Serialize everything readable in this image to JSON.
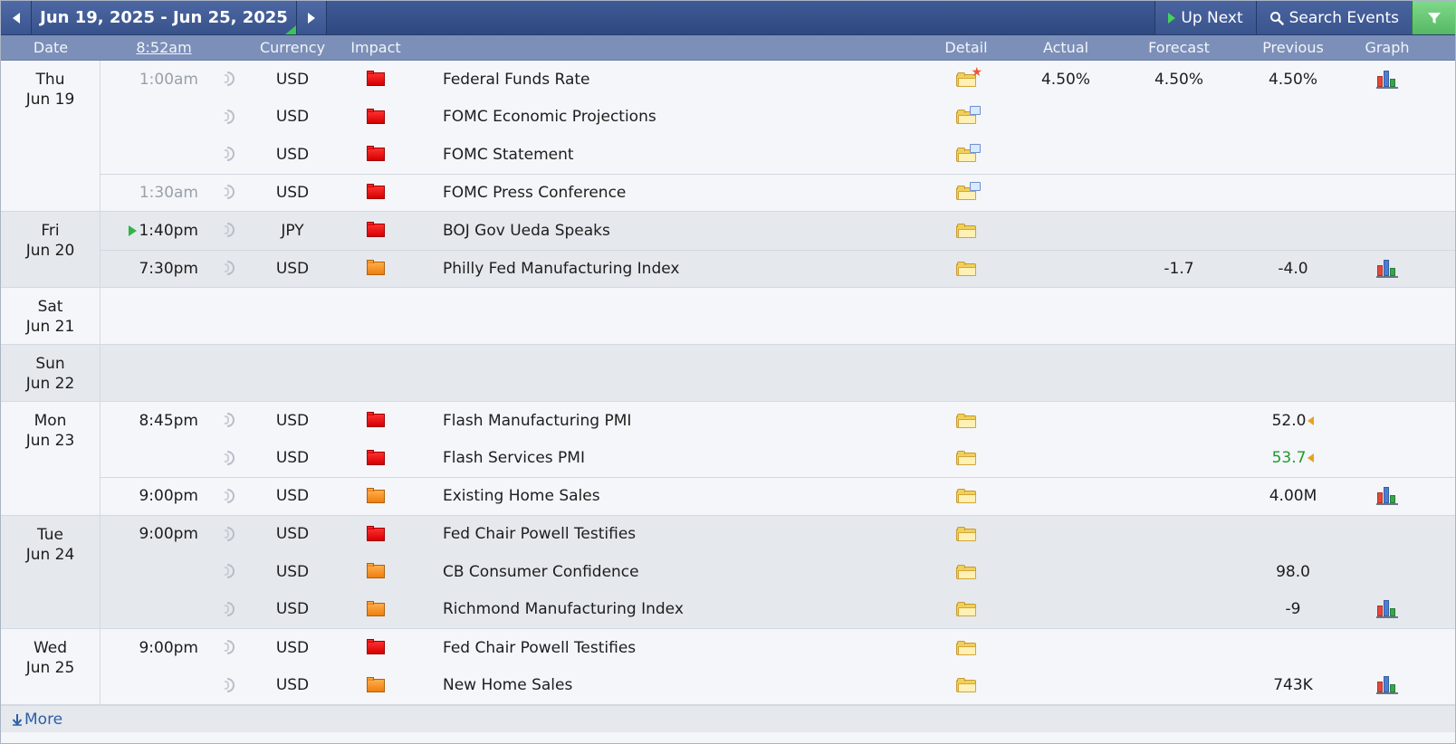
{
  "toolbar": {
    "date_range": "Jun 19, 2025 - Jun 25, 2025",
    "up_next": "Up Next",
    "search_events": "Search Events"
  },
  "headers": {
    "date": "Date",
    "time": "8:52am",
    "currency": "Currency",
    "impact": "Impact",
    "detail": "Detail",
    "actual": "Actual",
    "forecast": "Forecast",
    "previous": "Previous",
    "graph": "Graph"
  },
  "days": [
    {
      "day": "Thu",
      "date": "Jun 19",
      "events": [
        {
          "time": "1:00am",
          "currency": "USD",
          "impact": "high",
          "event": "Federal Funds Rate",
          "actual": "4.50%",
          "forecast": "4.50%",
          "previous": "4.50%"
        },
        {
          "time": "",
          "currency": "USD",
          "impact": "high",
          "event": "FOMC Economic Projections",
          "actual": "",
          "forecast": "",
          "previous": ""
        },
        {
          "time": "",
          "currency": "USD",
          "impact": "high",
          "event": "FOMC Statement",
          "actual": "",
          "forecast": "",
          "previous": ""
        },
        {
          "time": "1:30am",
          "currency": "USD",
          "impact": "high",
          "event": "FOMC Press Conference",
          "actual": "",
          "forecast": "",
          "previous": ""
        }
      ]
    },
    {
      "day": "Fri",
      "date": "Jun 20",
      "events": [
        {
          "time": "1:40pm",
          "currency": "JPY",
          "impact": "high",
          "event": "BOJ Gov Ueda Speaks",
          "actual": "",
          "forecast": "",
          "previous": ""
        },
        {
          "time": "7:30pm",
          "currency": "USD",
          "impact": "medium",
          "event": "Philly Fed Manufacturing Index",
          "actual": "",
          "forecast": "-1.7",
          "previous": "-4.0"
        }
      ]
    },
    {
      "day": "Sat",
      "date": "Jun 21",
      "events": []
    },
    {
      "day": "Sun",
      "date": "Jun 22",
      "events": []
    },
    {
      "day": "Mon",
      "date": "Jun 23",
      "events": [
        {
          "time": "8:45pm",
          "currency": "USD",
          "impact": "high",
          "event": "Flash Manufacturing PMI",
          "actual": "",
          "forecast": "",
          "previous": "52.0"
        },
        {
          "time": "",
          "currency": "USD",
          "impact": "high",
          "event": "Flash Services PMI",
          "actual": "",
          "forecast": "",
          "previous": "53.7"
        },
        {
          "time": "9:00pm",
          "currency": "USD",
          "impact": "medium",
          "event": "Existing Home Sales",
          "actual": "",
          "forecast": "",
          "previous": "4.00M"
        }
      ]
    },
    {
      "day": "Tue",
      "date": "Jun 24",
      "events": [
        {
          "time": "9:00pm",
          "currency": "USD",
          "impact": "high",
          "event": "Fed Chair Powell Testifies",
          "actual": "",
          "forecast": "",
          "previous": ""
        },
        {
          "time": "",
          "currency": "USD",
          "impact": "medium",
          "event": "CB Consumer Confidence",
          "actual": "",
          "forecast": "",
          "previous": "98.0"
        },
        {
          "time": "",
          "currency": "USD",
          "impact": "medium",
          "event": "Richmond Manufacturing Index",
          "actual": "",
          "forecast": "",
          "previous": "-9"
        }
      ]
    },
    {
      "day": "Wed",
      "date": "Jun 25",
      "events": [
        {
          "time": "9:00pm",
          "currency": "USD",
          "impact": "high",
          "event": "Fed Chair Powell Testifies",
          "actual": "",
          "forecast": "",
          "previous": ""
        },
        {
          "time": "",
          "currency": "USD",
          "impact": "medium",
          "event": "New Home Sales",
          "actual": "",
          "forecast": "",
          "previous": "743K"
        }
      ]
    }
  ],
  "footer": {
    "more": "More"
  },
  "colors": {
    "high_impact": "#e00000",
    "medium_impact": "#f08c1e",
    "positive": "#1f9a2c",
    "header_bg": "#7b8fb8",
    "topbar_bg": "#34508a"
  }
}
